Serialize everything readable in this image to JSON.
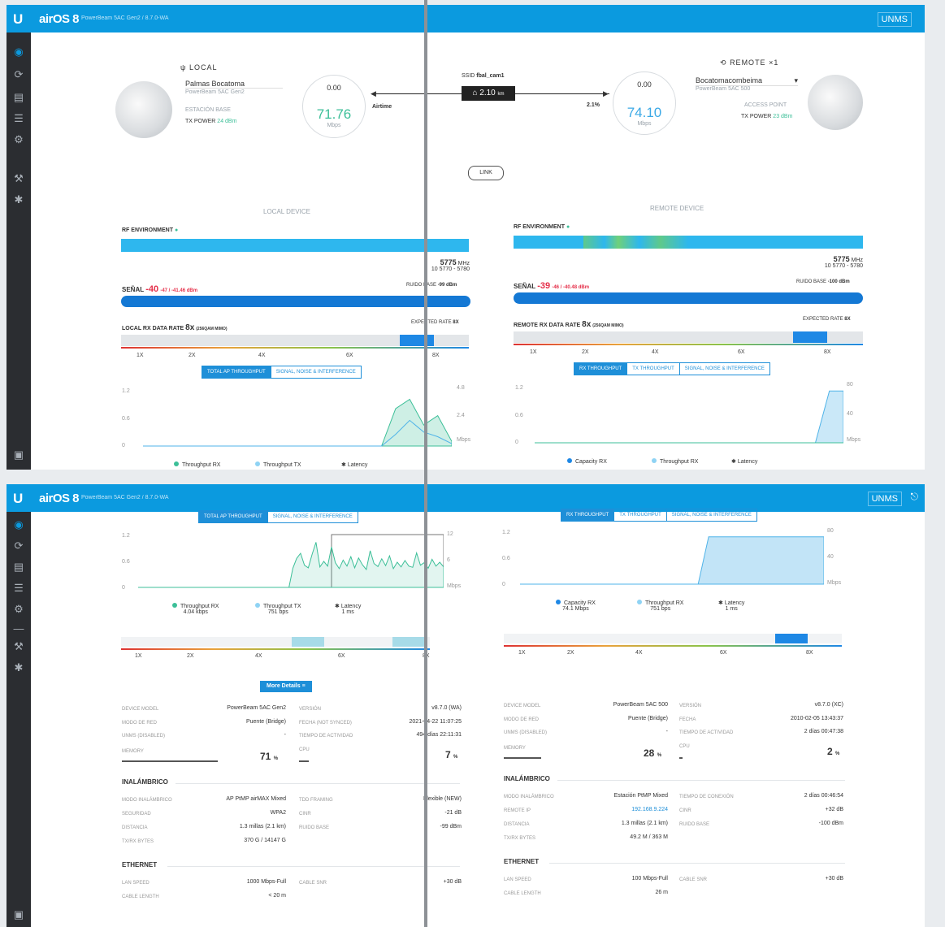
{
  "app": {
    "logo": "U",
    "name": "airOS 8",
    "subtitle": "PowerBeam 5AC Gen2 / 8.7.0-WA",
    "unms": "UNMS"
  },
  "sidebar_icons": [
    "dashboard-icon",
    "refresh-icon",
    "wireless-icon",
    "network-icon",
    "services-icon",
    "system-icon",
    "tools-icon",
    "settings-icon",
    "terminal-icon"
  ],
  "local": {
    "title": "LOCAL",
    "device_name": "Palmas Bocatoma",
    "model_line": "PowerBeam 5AC Gen2",
    "role": "ESTACIÓN BASE",
    "tx_power_label": "TX POWER",
    "tx_power_value": "24 dBm",
    "capacity_small": "0.00",
    "capacity_big": "71.76",
    "unit": "Mbps"
  },
  "link": {
    "ssid_label": "SSID",
    "ssid": "fbal_cam1",
    "distance": "2.10",
    "distance_unit": "km",
    "airtime_label": "Airtime",
    "airtime_value": "2.1",
    "airtime_unit": "%",
    "center_tab": "LINK"
  },
  "remote": {
    "title": "REMOTE",
    "count": "1",
    "device_name": "Bocatomacombeima",
    "model_line": "PowerBeam 5AC 500",
    "role": "ACCESS POINT",
    "tx_power_label": "TX POWER",
    "tx_power_value": "23 dBm",
    "capacity_small": "0.00",
    "capacity_big": "74.10",
    "unit": "Mbps"
  },
  "local_device": {
    "section": "LOCAL DEVICE",
    "rf_env_label": "RF ENVIRONMENT",
    "freq": "5775",
    "freq_unit": "MHz",
    "band": "5770 - 5780",
    "band_prefix": "10",
    "signal_label": "SEÑAL",
    "signal_value": "-40",
    "signal_detail": "-47 / -41.46 dBm",
    "noise_label": "RUIDO BASE",
    "noise_value": "-99 dBm",
    "rate_label": "LOCAL RX DATA RATE",
    "rate_value": "8x",
    "rate_mod": "(256QAM MIMO)",
    "expected_label": "EXPECTED RATE",
    "expected_value": "8X",
    "rate_ticks": [
      "1X",
      "2X",
      "4X",
      "6X",
      "8X"
    ],
    "tabs": [
      "TOTAL AP THROUGHPUT",
      "SIGNAL, NOISE & INTERFERENCE"
    ],
    "y_left": [
      "1.2",
      "0.6",
      "0"
    ],
    "y_right": [
      "4.8",
      "2.4",
      "Mbps"
    ],
    "legend": [
      "Throughput RX",
      "Throughput TX",
      "Latency"
    ]
  },
  "remote_device": {
    "section": "REMOTE DEVICE",
    "rf_env_label": "RF ENVIRONMENT",
    "freq": "5775",
    "freq_unit": "MHz",
    "band": "5770 - 5780",
    "band_prefix": "10",
    "signal_label": "SEÑAL",
    "signal_value": "-39",
    "signal_detail": "-46 / -40.48 dBm",
    "noise_label": "RUIDO BASE",
    "noise_value": "-100 dBm",
    "rate_label": "REMOTE RX DATA RATE",
    "rate_value": "8x",
    "rate_mod": "(256QAM MIMO)",
    "expected_label": "EXPECTED RATE",
    "expected_value": "8X",
    "rate_ticks": [
      "1X",
      "2X",
      "4X",
      "6X",
      "8X"
    ],
    "tabs": [
      "RX THROUGHPUT",
      "TX THROUGHPUT",
      "SIGNAL, NOISE & INTERFERENCE"
    ],
    "y_left": [
      "1.2",
      "0.6",
      "0"
    ],
    "y_right": [
      "80",
      "40",
      "Mbps"
    ],
    "legend": [
      "Capacity RX",
      "Throughput RX",
      "Latency"
    ]
  },
  "local_bottom": {
    "tabs": [
      "TOTAL AP THROUGHPUT",
      "SIGNAL, NOISE & INTERFERENCE"
    ],
    "y_left": [
      "1.2",
      "0.6",
      "0"
    ],
    "y_right": [
      "12",
      "6",
      "Mbps"
    ],
    "legend": [
      {
        "name": "Throughput RX",
        "value": "4.04 kbps"
      },
      {
        "name": "Throughput TX",
        "value": "751 bps"
      },
      {
        "name": "Latency",
        "value": "1 ms"
      }
    ],
    "more_details": "More Details",
    "rate_ticks": [
      "1X",
      "2X",
      "4X",
      "6X",
      "8X"
    ],
    "rows_left": [
      {
        "label": "DEVICE MODEL",
        "value": "PowerBeam 5AC Gen2"
      },
      {
        "label": "MODO DE RED",
        "value": "Puente (Bridge)"
      },
      {
        "label": "UNMS (DISABLED)",
        "value": "-"
      }
    ],
    "rows_right": [
      {
        "label": "VERSIÓN",
        "value": "v8.7.0 (WA)"
      },
      {
        "label": "FECHA (NOT SYNCED)",
        "value": "2021-04-22 11:07:25"
      },
      {
        "label": "TIEMPO DE ACTIVIDAD",
        "value": "494 días 22:11:31"
      }
    ],
    "memory_label": "MEMORY",
    "memory_value": "71",
    "cpu_label": "CPU",
    "cpu_value": "7",
    "wireless_title": "INALÁMBRICO",
    "wireless_left": [
      {
        "label": "MODO INALÁMBRICO",
        "value": "AP PtMP airMAX Mixed"
      },
      {
        "label": "SEGURIDAD",
        "value": "WPA2"
      },
      {
        "label": "DISTANCIA",
        "value": "1.3 millas (2.1 km)"
      },
      {
        "label": "TX/RX BYTES",
        "value": "370 G / 14147 G"
      }
    ],
    "wireless_right": [
      {
        "label": "TDD FRAMING",
        "value": "Flexible (NEW)"
      },
      {
        "label": "CINR",
        "value": "-21 dB"
      },
      {
        "label": "RUIDO BASE",
        "value": "-99 dBm"
      }
    ],
    "ethernet_title": "ETHERNET",
    "ethernet_left": [
      {
        "label": "LAN SPEED",
        "value": "1000 Mbps-Full"
      },
      {
        "label": "CABLE LENGTH",
        "value": "< 20 m"
      }
    ],
    "ethernet_right": [
      {
        "label": "CABLE SNR",
        "value": "+30 dB"
      }
    ]
  },
  "remote_bottom": {
    "tabs": [
      "RX THROUGHPUT",
      "TX THROUGHPUT",
      "SIGNAL, NOISE & INTERFERENCE"
    ],
    "y_left": [
      "1.2",
      "0.6",
      "0"
    ],
    "y_right": [
      "80",
      "40",
      "Mbps"
    ],
    "legend": [
      {
        "name": "Capacity RX",
        "value": "74.1 Mbps"
      },
      {
        "name": "Throughput RX",
        "value": "751 bps"
      },
      {
        "name": "Latency",
        "value": "1 ms"
      }
    ],
    "rate_ticks": [
      "1X",
      "2X",
      "4X",
      "6X",
      "8X"
    ],
    "rows_left": [
      {
        "label": "DEVICE MODEL",
        "value": "PowerBeam 5AC 500"
      },
      {
        "label": "MODO DE RED",
        "value": "Puente (Bridge)"
      },
      {
        "label": "UNMS (DISABLED)",
        "value": "-"
      }
    ],
    "rows_right": [
      {
        "label": "VERSIÓN",
        "value": "v8.7.0 (XC)"
      },
      {
        "label": "FECHA",
        "value": "2010-02-05 13:43:37"
      },
      {
        "label": "TIEMPO DE ACTIVIDAD",
        "value": "2 días 00:47:38"
      }
    ],
    "memory_label": "MEMORY",
    "memory_value": "28",
    "cpu_label": "CPU",
    "cpu_value": "2",
    "wireless_title": "INALÁMBRICO",
    "wireless_left": [
      {
        "label": "MODO INALÁMBRICO",
        "value": "Estación PtMP Mixed"
      },
      {
        "label": "REMOTE IP",
        "value": "192.168.9.224"
      },
      {
        "label": "DISTANCIA",
        "value": "1.3 millas (2.1 km)"
      },
      {
        "label": "TX/RX BYTES",
        "value": "49.2 M / 363 M"
      }
    ],
    "wireless_right": [
      {
        "label": "TIEMPO DE CONEXIÓN",
        "value": "2 días 00:46:54"
      },
      {
        "label": "CINR",
        "value": "+32 dB"
      },
      {
        "label": "RUIDO BASE",
        "value": "-100 dBm"
      }
    ],
    "ethernet_title": "ETHERNET",
    "ethernet_left": [
      {
        "label": "LAN SPEED",
        "value": "100 Mbps-Full"
      },
      {
        "label": "CABLE LENGTH",
        "value": "26 m"
      }
    ],
    "ethernet_right": [
      {
        "label": "CABLE SNR",
        "value": "+30 dB"
      }
    ]
  },
  "colors": {
    "accent": "#0b9adf",
    "green": "#3cbf98",
    "red": "#e5304a",
    "sidebar": "#2b2d31"
  },
  "chart_data": [
    {
      "type": "area",
      "title": "",
      "series": [
        {
          "name": "Throughput RX",
          "values": [
            0,
            0,
            0,
            0,
            0,
            0,
            0,
            0,
            0,
            0,
            0,
            0,
            0,
            0,
            0,
            0,
            0,
            0,
            3.2,
            4.0,
            1.8,
            2.6,
            0.4
          ]
        },
        {
          "name": "Throughput TX",
          "values": [
            0,
            0,
            0,
            0,
            0,
            0,
            0,
            0,
            0,
            0,
            0,
            0,
            0,
            0,
            0,
            0,
            0,
            0,
            1.0,
            2.2,
            1.2,
            0.8,
            0.2
          ]
        }
      ],
      "ylim": [
        0,
        4.8
      ],
      "y2lim": [
        0,
        1.2
      ],
      "units": "Mbps"
    },
    {
      "type": "area",
      "title": "",
      "series": [
        {
          "name": "Capacity RX",
          "values": [
            0,
            0,
            0,
            0,
            0,
            0,
            0,
            0,
            0,
            0,
            0,
            0,
            0,
            0,
            0,
            0,
            0,
            0,
            0,
            0,
            0,
            74,
            74
          ]
        },
        {
          "name": "Throughput RX",
          "values": [
            0,
            0,
            0,
            0,
            0,
            0,
            0,
            0,
            0,
            0,
            0,
            0,
            0,
            0,
            0,
            0,
            0,
            0,
            0,
            0,
            0,
            0,
            0
          ]
        }
      ],
      "ylim": [
        0,
        80
      ],
      "y2lim": [
        0,
        1.2
      ],
      "units": "Mbps"
    },
    {
      "type": "line",
      "title": "",
      "series": [
        {
          "name": "Throughput RX",
          "values": [
            0,
            0,
            0,
            0,
            0,
            0,
            0,
            0,
            0,
            0,
            0,
            0,
            0,
            0,
            0,
            0,
            0,
            0,
            0,
            0,
            0,
            0,
            0,
            0,
            0,
            0,
            0,
            0,
            0,
            0,
            0,
            0,
            0,
            0,
            0,
            0,
            0,
            0,
            0,
            0,
            4.5,
            6.8,
            8.0,
            5.2,
            4.6,
            7.8,
            10.6,
            4.8,
            6.1,
            5.0,
            9.5,
            5.8,
            4.4,
            6.4,
            5.0,
            7.2,
            4.6,
            6.9,
            5.3,
            4.2,
            8.6,
            5.6,
            4.9,
            6.7,
            5.1,
            7.4,
            4.4,
            5.9,
            4.8,
            6.3,
            5.0,
            4.7,
            8.1,
            5.2,
            5.8,
            4.5,
            6.6,
            5.0,
            5.9,
            4.8
          ]
        }
      ],
      "ylim": [
        0,
        12
      ],
      "units": "Mbps"
    },
    {
      "type": "area",
      "title": "",
      "series": [
        {
          "name": "Capacity RX",
          "values": [
            0,
            0,
            0,
            0,
            0,
            0,
            0,
            0,
            0,
            0,
            0,
            0,
            0,
            0,
            0,
            0,
            0,
            0,
            74,
            74,
            74,
            74,
            74,
            74,
            74,
            74,
            74,
            74,
            74,
            74
          ]
        }
      ],
      "ylim": [
        0,
        80
      ],
      "units": "Mbps"
    }
  ]
}
